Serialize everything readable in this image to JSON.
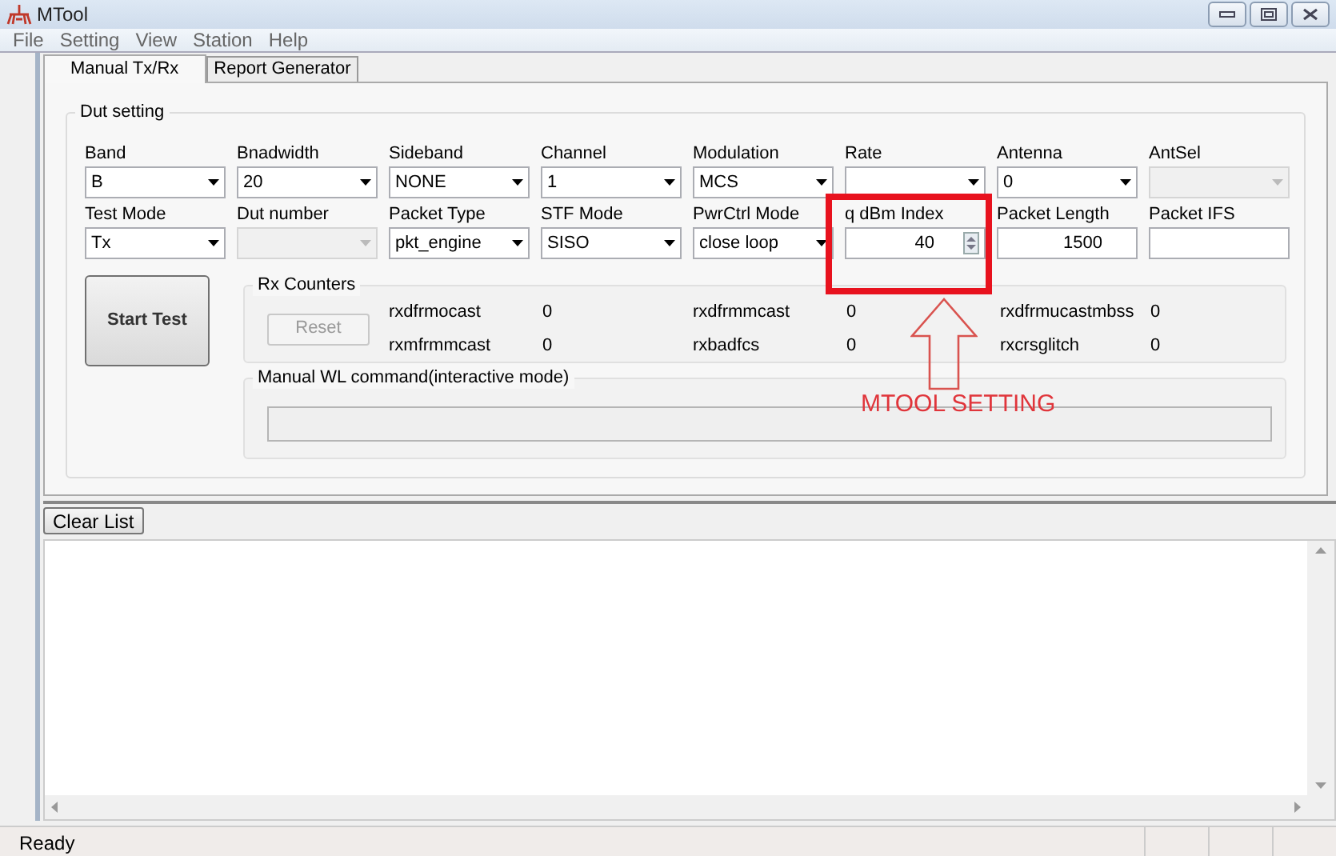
{
  "window": {
    "title": "MTool"
  },
  "menu": [
    "File",
    "Setting",
    "View",
    "Station",
    "Help"
  ],
  "tabs": [
    {
      "label": "Manual Tx/Rx",
      "selected": true
    },
    {
      "label": "Report Generator",
      "selected": false
    }
  ],
  "dut_setting": {
    "title": "Dut setting",
    "fields": [
      {
        "label": "Band",
        "kind": "combo",
        "value": "B",
        "disabled": false
      },
      {
        "label": "Bnadwidth",
        "kind": "combo",
        "value": "20",
        "disabled": false
      },
      {
        "label": "Sideband",
        "kind": "combo",
        "value": "NONE",
        "disabled": false
      },
      {
        "label": "Channel",
        "kind": "combo",
        "value": "1",
        "disabled": false
      },
      {
        "label": "Modulation",
        "kind": "combo",
        "value": "MCS",
        "disabled": false
      },
      {
        "label": "Rate",
        "kind": "combo",
        "disabled": false
      },
      {
        "label": "Antenna",
        "kind": "combo",
        "value": "0",
        "disabled": false
      },
      {
        "label": "AntSel",
        "kind": "combo",
        "disabled": true
      },
      {
        "label": "Test Mode",
        "kind": "combo",
        "value": "Tx",
        "disabled": false
      },
      {
        "label": "Dut number",
        "kind": "combo",
        "disabled": true
      },
      {
        "label": "Packet Type",
        "kind": "combo",
        "value": "pkt_engine",
        "disabled": false
      },
      {
        "label": "STF Mode",
        "kind": "combo",
        "value": "SISO",
        "disabled": false
      },
      {
        "label": "PwrCtrl Mode",
        "kind": "combo",
        "value": "close loop",
        "disabled": false
      },
      {
        "label": "q dBm Index",
        "kind": "spin",
        "value": "40",
        "disabled": false
      },
      {
        "label": "Packet Length",
        "kind": "text",
        "value": "1500",
        "disabled": false
      },
      {
        "label": "Packet IFS",
        "kind": "text",
        "disabled": false
      }
    ],
    "start_button": "Start Test",
    "rx_counters": {
      "title": "Rx Counters",
      "reset": {
        "label": "Reset",
        "disabled": true
      },
      "counters": [
        {
          "name": "rxdfrmocast",
          "value": "0"
        },
        {
          "name": "rxdfrmmcast",
          "value": "0"
        },
        {
          "name": "rxdfrmucastmbss",
          "value": "0"
        },
        {
          "name": "rxmfrmmcast",
          "value": "0"
        },
        {
          "name": "rxbadfcs",
          "value": "0"
        },
        {
          "name": "rxcrsglitch",
          "value": "0"
        }
      ]
    },
    "wl_command": {
      "title": "Manual WL command(interactive mode)"
    }
  },
  "annotation": {
    "label": "MTOOL SETTING"
  },
  "log": {
    "clear_button": "Clear List"
  },
  "status_bar": {
    "text": "Ready"
  }
}
